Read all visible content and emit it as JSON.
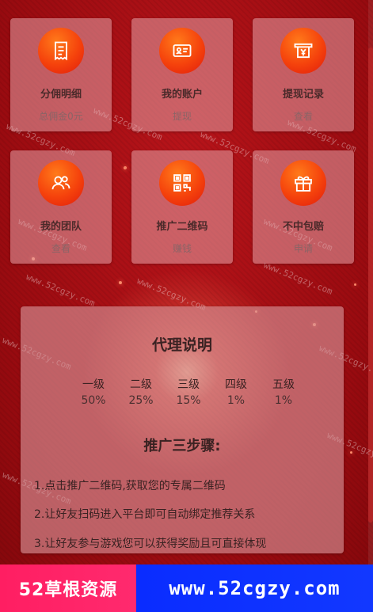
{
  "grid": [
    {
      "title": "分佣明细",
      "sub": "总佣金0元",
      "icon": "receipt-icon"
    },
    {
      "title": "我的账户",
      "sub": "提现",
      "icon": "id-card-icon"
    },
    {
      "title": "提现记录",
      "sub": "查看",
      "icon": "withdraw-yen-icon"
    },
    {
      "title": "我的团队",
      "sub": "查看",
      "icon": "team-icon"
    },
    {
      "title": "推广二维码",
      "sub": "赚钱",
      "icon": "qrcode-icon"
    },
    {
      "title": "不中包赔",
      "sub": "申请",
      "icon": "gift-icon"
    }
  ],
  "panel": {
    "title": "代理说明",
    "levels": [
      {
        "name": "一级",
        "pct": "50%"
      },
      {
        "name": "二级",
        "pct": "25%"
      },
      {
        "name": "三级",
        "pct": "15%"
      },
      {
        "name": "四级",
        "pct": "1%"
      },
      {
        "name": "五级",
        "pct": "1%"
      }
    ],
    "steps_title": "推广三步骤:",
    "steps": [
      "1.点击推广二维码,获取您的专属二维码",
      "2.让好友扫码进入平台即可自动绑定推荐关系",
      "3.让好友参与游戏您可以获得奖励且可直接体现"
    ]
  },
  "watermark": "www.52cgzy.com",
  "footer": {
    "left": "52草根资源",
    "right": "www.52cgzy.com"
  },
  "colors": {
    "background": "#a80d10",
    "icon_gradient": "#f5420c",
    "footer_left": "#ff1e62",
    "footer_right": "#0a2cff"
  }
}
